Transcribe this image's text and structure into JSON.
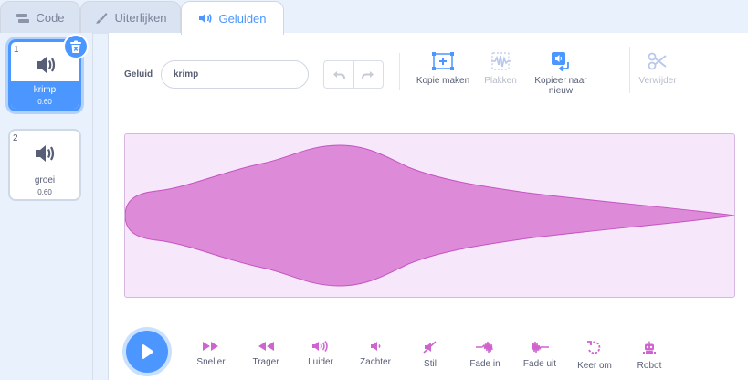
{
  "tabs": [
    {
      "label": "Code",
      "icon": "code-blocks-icon"
    },
    {
      "label": "Uiterlijken",
      "icon": "paintbrush-icon"
    },
    {
      "label": "Geluiden",
      "icon": "speaker-icon",
      "active": true
    }
  ],
  "sounds": [
    {
      "index": "1",
      "name": "krimp",
      "duration": "0.60",
      "selected": true
    },
    {
      "index": "2",
      "name": "groei",
      "duration": "0.60",
      "selected": false
    }
  ],
  "editor": {
    "name_label": "Geluid",
    "name_value": "krimp",
    "copy_label": "Kopie maken",
    "paste_label": "Plakken",
    "copy_new_label": "Kopieer naar nieuw",
    "delete_label": "Verwijder"
  },
  "effects": [
    {
      "label": "Sneller",
      "icon": "faster-icon"
    },
    {
      "label": "Trager",
      "icon": "slower-icon"
    },
    {
      "label": "Luider",
      "icon": "louder-icon"
    },
    {
      "label": "Zachter",
      "icon": "softer-icon"
    },
    {
      "label": "Stil",
      "icon": "mute-icon"
    },
    {
      "label": "Fade in",
      "icon": "fade-in-icon"
    },
    {
      "label": "Fade uit",
      "icon": "fade-out-icon"
    },
    {
      "label": "Keer om",
      "icon": "reverse-icon"
    },
    {
      "label": "Robot",
      "icon": "robot-icon"
    }
  ],
  "colors": {
    "accent": "#4c97ff",
    "sound_purple": "#cf63cf",
    "wave_fill": "#dd8ad9"
  }
}
